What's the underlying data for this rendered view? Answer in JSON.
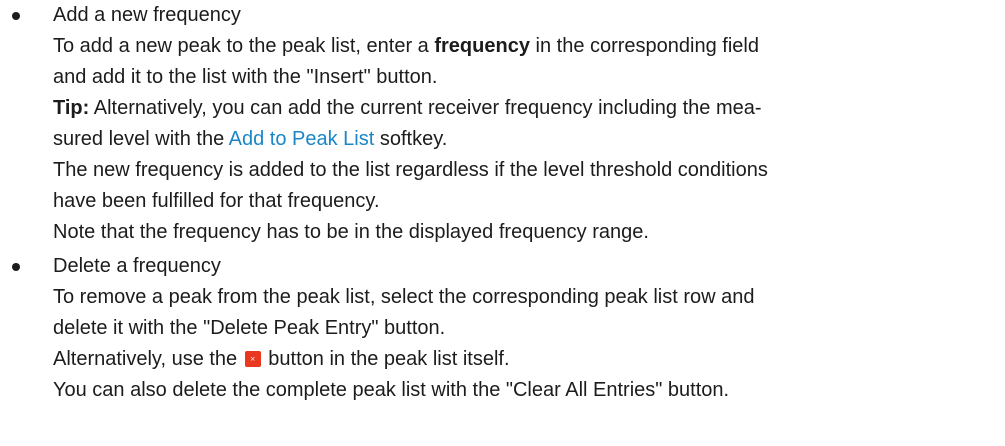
{
  "items": [
    {
      "heading": "Add a new frequency",
      "para1_a": "To add a new peak to the peak list, enter a ",
      "para1_bold": "frequency",
      "para1_b": " in the corresponding field",
      "para1_c": "and add it to the list with the \"Insert\" button.",
      "tip_label": "Tip:",
      "tip_a": " Alternatively, you can add the current receiver frequency including the mea-",
      "tip_b": "sured level with the ",
      "tip_link": "Add to Peak List",
      "tip_c": " softkey.",
      "para3_a": "The new frequency is added to the list regardless if the level threshold conditions",
      "para3_b": "have been fulfilled for that frequency.",
      "para4": "Note that the frequency has to be in the displayed frequency range."
    },
    {
      "heading": "Delete a frequency",
      "para1_a": "To remove a peak from the peak list, select the corresponding peak list row and",
      "para1_b": "delete it with the \"Delete Peak Entry\" button.",
      "para2_a": "Alternatively, use the ",
      "button_icon": "delete-x-icon",
      "button_glyph": "×",
      "button_color": "#e8381f",
      "para2_b": " button in the peak list itself.",
      "para3": "You can also delete the complete peak list with the \"Clear All Entries\" button."
    }
  ],
  "link_color": "#1a86c8"
}
